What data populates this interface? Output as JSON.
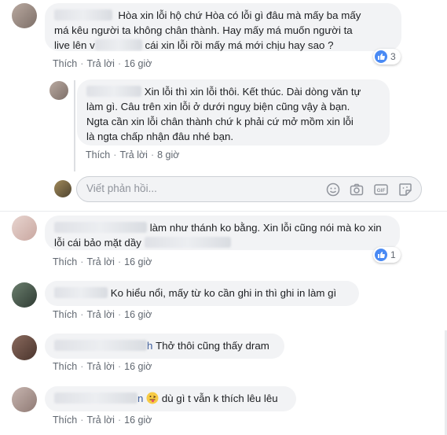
{
  "comments": [
    {
      "text_line1": "Hòa xin lỗi hộ chứ Hòa có lỗi gì đâu mà mấy ba mấy",
      "text_line2": "má kêu người ta không chân thành. Hay mấy má muốn người ta",
      "text_line3a": "live lên v",
      "text_line3b": "cái xin lỗi rồi mấy má mới chịu hay sao ?",
      "like": "Thích",
      "reply": "Trả lời",
      "time": "16 giờ",
      "reaction_count": "3"
    },
    {
      "text_line1": "Xin lỗi thì xin lỗi thôi. Kết thúc. Dài dòng văn tự",
      "text_line2": "làm gì. Câu trên xin lỗi ở dưới nguỵ biện cũng vậy à bạn.",
      "text_line3": "Ngta cần xin lỗi chân thành chứ k phải cứ mở mồm xin lỗi",
      "text_line4": "là ngta chấp nhận đâu nhé bạn.",
      "like": "Thích",
      "reply": "Trả lời",
      "time": "8 giờ"
    },
    {
      "text_line1": "làm như thánh ko bằng. Xin lỗi cũng nói mà ko xin",
      "text_line2": "lỗi cái bảo mặt dầy",
      "like": "Thích",
      "reply": "Trả lời",
      "time": "16 giờ",
      "reaction_count": "1"
    },
    {
      "text_line1": "Ko hiểu nổi, mấy từ ko cần ghi in thì ghi in làm gì",
      "like": "Thích",
      "reply": "Trả lời",
      "time": "16 giờ"
    },
    {
      "name_suffix": "h",
      "text_line1": "Thở thôi cũng thấy dram",
      "like": "Thích",
      "reply": "Trả lời",
      "time": "16 giờ"
    },
    {
      "name_suffix": "n",
      "text_line1": "dù gì t vẫn k thích lêu lêu",
      "like": "Thích",
      "reply": "Trả lời",
      "time": "16 giờ"
    }
  ],
  "reply_box": {
    "placeholder": "Viết phản hồi..."
  },
  "icons": [
    "emoji-icon",
    "camera-icon",
    "gif-icon",
    "sticker-icon",
    "like-icon"
  ]
}
